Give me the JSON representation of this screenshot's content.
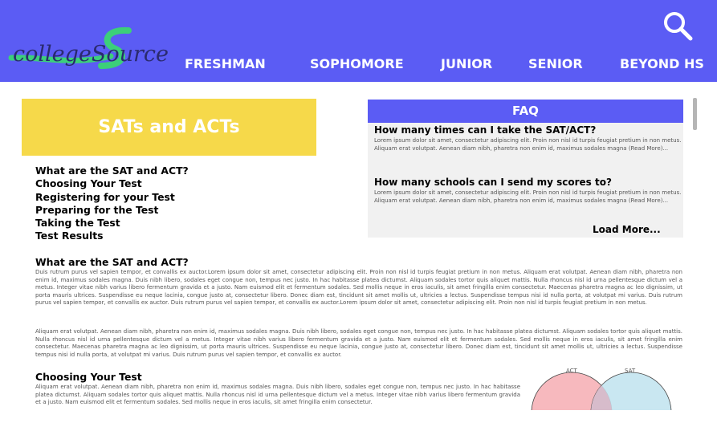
{
  "header": {
    "logo_text": "collegeSource",
    "nav": [
      "FRESHMAN",
      "SOPHOMORE",
      "JUNIOR",
      "SENIOR",
      "BEYOND HS"
    ],
    "search_icon": "search-icon",
    "colors": {
      "bar": "#5b5cf4",
      "logo_swoosh": "#3ccf7a",
      "logo_text": "#2a2a6e"
    }
  },
  "hero": {
    "title": "SATs and ACTs",
    "color": "#f6d94a"
  },
  "toc": [
    "What are the SAT and ACT?",
    "Choosing Your Test",
    "Registering for your Test",
    "Preparing for the Test",
    "Taking the Test",
    "Test Results"
  ],
  "faq": {
    "title": "FAQ",
    "entries": [
      {
        "question": "How many times can I take the SAT/ACT?",
        "answer": "Lorem ipsum dolor sit amet, consectetur adipiscing elit. Proin non nisl id turpis feugiat pretium in non metus. Aliquam erat volutpat. Aenean diam nibh, pharetra non enim id, maximus sodales magna (Read More)..."
      },
      {
        "question": "How many schools can I send my scores to?",
        "answer": "Lorem ipsum dolor sit amet, consectetur adipiscing elit. Proin non nisl id turpis feugiat pretium in non metus. Aliquam erat volutpat. Aenean diam nibh, pharetra non enim id, maximus sodales magna (Read More)..."
      }
    ],
    "load_more": "Load More..."
  },
  "sections": {
    "what": {
      "title": "What are the SAT and ACT?",
      "p1": "Duis rutrum purus vel sapien tempor, et convallis ex auctor.Lorem ipsum dolor sit amet, consectetur adipiscing elit. Proin non nisl id turpis feugiat pretium in non metus. Aliquam erat volutpat. Aenean diam nibh, pharetra non enim id, maximus sodales magna. Duis nibh libero, sodales eget congue non, tempus nec justo. In hac habitasse platea dictumst. Aliquam sodales tortor quis aliquet mattis. Nulla rhoncus nisl id urna pellentesque dictum vel a metus. Integer vitae nibh varius libero fermentum gravida et a justo. Nam euismod elit et fermentum sodales. Sed mollis neque in eros iaculis, sit amet fringilla enim consectetur. Maecenas pharetra magna ac leo dignissim, ut porta mauris ultrices. Suspendisse eu neque lacinia, congue justo at, consectetur libero. Donec diam est, tincidunt sit amet mollis ut, ultricies a lectus. Suspendisse tempus nisi id nulla porta, at volutpat mi varius. Duis rutrum purus vel sapien tempor, et convallis ex auctor. Duis rutrum purus vel sapien tempor, et convallis ex auctor.Lorem ipsum dolor sit amet, consectetur adipiscing elit. Proin non nisl id turpis feugiat pretium in non metus.",
      "p2": "Aliquam erat volutpat. Aenean diam nibh, pharetra non enim id, maximus sodales magna. Duis nibh libero, sodales eget congue non, tempus nec justo. In hac habitasse platea dictumst. Aliquam sodales tortor quis aliquet mattis. Nulla rhoncus nisl id urna pellentesque dictum vel a metus. Integer vitae nibh varius libero fermentum gravida et a justo. Nam euismod elit et fermentum sodales. Sed mollis neque in eros iaculis, sit amet fringilla enim consectetur. Maecenas pharetra magna ac leo dignissim, ut porta mauris ultrices. Suspendisse eu neque lacinia, congue justo at, consectetur libero. Donec diam est, tincidunt sit amet mollis ut, ultricies a lectus. Suspendisse tempus nisi id nulla porta, at volutpat mi varius. Duis rutrum purus vel sapien tempor, et convallis ex auctor."
    },
    "choosing": {
      "title": "Choosing Your Test",
      "p1": "Aliquam erat volutpat. Aenean diam nibh, pharetra non enim id, maximus sodales magna. Duis nibh libero, sodales eget congue non, tempus nec justo. In hac habitasse platea dictumst. Aliquam sodales tortor quis aliquet mattis. Nulla rhoncus nisl id urna pellentesque dictum vel a metus. Integer vitae nibh varius libero fermentum gravida et a justo. Nam euismod elit et fermentum sodales. Sed mollis neque in eros iaculis, sit amet fringilla enim consectetur."
    }
  },
  "venn": {
    "left_label": "ACT",
    "right_label": "SAT",
    "left_color": "#f7b9be",
    "right_color": "#bfe3ee"
  }
}
